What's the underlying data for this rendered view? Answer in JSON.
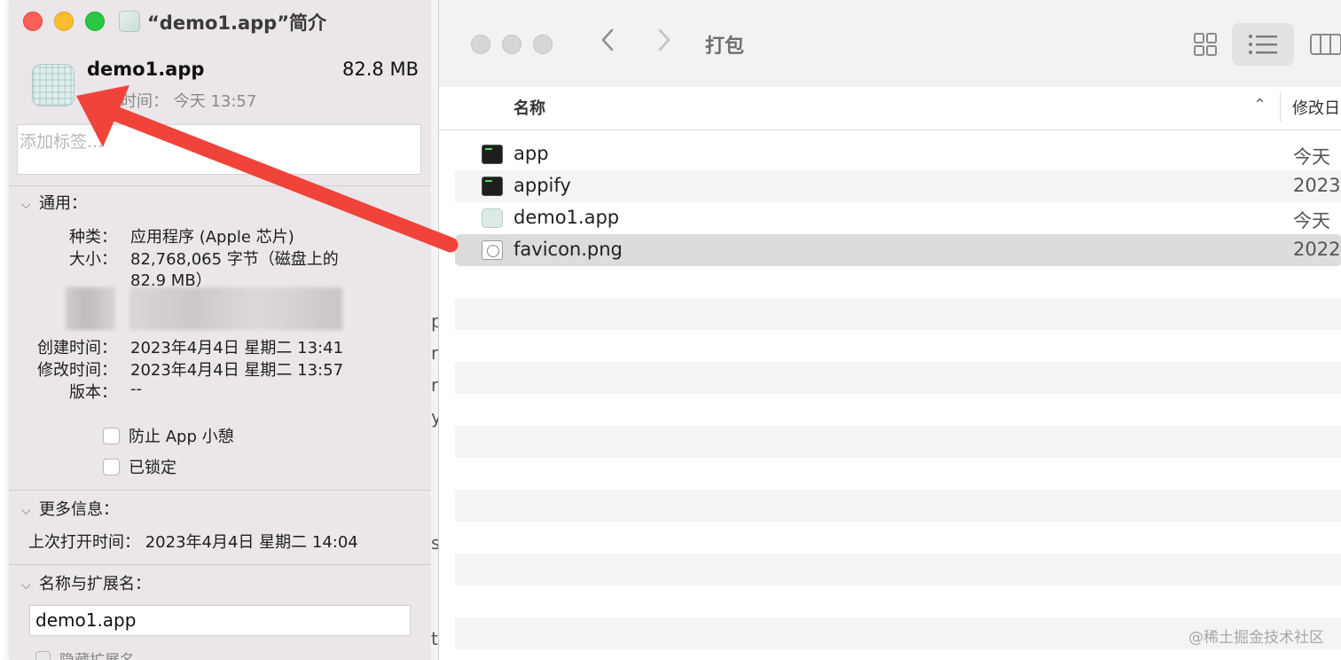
{
  "info_window": {
    "title": "“demo1.app”简介",
    "app_name": "demo1.app",
    "app_size": "82.8 MB",
    "modified_line": "修改时间： 今天 13:57",
    "tags_placeholder": "添加标签...",
    "general": {
      "header": "通用：",
      "kind_label": "种类：",
      "kind_value": "应用程序 (Apple 芯片)",
      "size_label": "大小：",
      "size_value_line1": "82,768,065 字节（磁盘上的",
      "size_value_line2": "82.9 MB）",
      "created_label": "创建时间：",
      "created_value": "2023年4月4日 星期二 13:41",
      "modified_label": "修改时间：",
      "modified_value": "2023年4月4日 星期二 13:57",
      "version_label": "版本：",
      "version_value": "--",
      "prevent_nap_label": "防止 App 小憩",
      "locked_label": "已锁定"
    },
    "more_info": {
      "header": "更多信息：",
      "last_opened": "上次打开时间： 2023年4月4日 星期二 14:04"
    },
    "name_ext": {
      "header": "名称与扩展名：",
      "name_value": "demo1.app",
      "hide_ext_label": "隐藏扩展名"
    }
  },
  "background_text": [
    "p",
    "ra",
    "r",
    "y",
    "s",
    "te"
  ],
  "finder": {
    "title": "打包",
    "back_icon": "chevron-left-icon",
    "forward_icon": "chevron-right-icon",
    "columns": {
      "name": "名称",
      "modified": "修改日"
    },
    "files": [
      {
        "name": "app",
        "date": "今天 ",
        "icon": "terminal-icon"
      },
      {
        "name": "appify",
        "date": "2023",
        "icon": "terminal-icon"
      },
      {
        "name": "demo1.app",
        "date": "今天 ",
        "icon": "app-icon"
      },
      {
        "name": "favicon.png",
        "date": "2022",
        "icon": "png-file-icon",
        "selected": true
      }
    ]
  },
  "watermark": "@稀土掘金技术社区",
  "colors": {
    "arrow": "#f0443a",
    "close": "#fe5f57",
    "minimize": "#febc2e",
    "zoom": "#28c840"
  }
}
